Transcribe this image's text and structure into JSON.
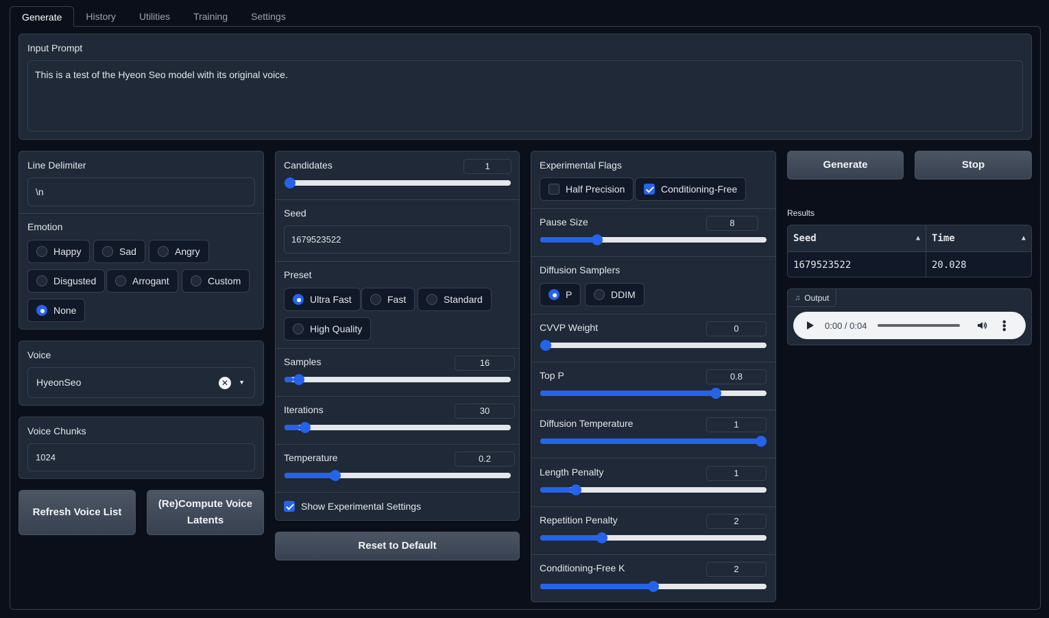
{
  "tabs": [
    "Generate",
    "History",
    "Utilities",
    "Training",
    "Settings"
  ],
  "input_prompt": {
    "label": "Input Prompt",
    "value": "This is a test of the Hyeon Seo model with its original voice."
  },
  "line_delimiter": {
    "label": "Line Delimiter",
    "value": "\\n"
  },
  "emotion": {
    "label": "Emotion",
    "options": [
      "Happy",
      "Sad",
      "Angry",
      "Disgusted",
      "Arrogant",
      "Custom",
      "None"
    ],
    "selected": "None"
  },
  "voice": {
    "label": "Voice",
    "value": "HyeonSeo"
  },
  "voice_chunks": {
    "label": "Voice Chunks",
    "value": "1024"
  },
  "buttons": {
    "refresh_voice_list": "Refresh Voice List",
    "recompute_latents": "(Re)Compute Voice Latents",
    "reset_to_default": "Reset to Default",
    "generate": "Generate",
    "stop": "Stop"
  },
  "candidates": {
    "label": "Candidates",
    "value": "1",
    "fraction": 0.0
  },
  "seed": {
    "label": "Seed",
    "value": "1679523522"
  },
  "preset": {
    "label": "Preset",
    "options": [
      "Ultra Fast",
      "Fast",
      "Standard",
      "High Quality"
    ],
    "selected": "Ultra Fast"
  },
  "samples": {
    "label": "Samples",
    "value": "16",
    "fraction": 0.04
  },
  "iterations": {
    "label": "Iterations",
    "value": "30",
    "fraction": 0.07
  },
  "temperature": {
    "label": "Temperature",
    "value": "0.2",
    "fraction": 0.21
  },
  "show_experimental": {
    "label": "Show Experimental Settings",
    "checked": true
  },
  "experimental_flags": {
    "label": "Experimental Flags",
    "half_precision": {
      "label": "Half Precision",
      "checked": false
    },
    "conditioning_free": {
      "label": "Conditioning-Free",
      "checked": true
    }
  },
  "pause_size": {
    "label": "Pause Size",
    "value": "8",
    "fraction": 0.24
  },
  "diffusion_samplers": {
    "label": "Diffusion Samplers",
    "options": [
      "P",
      "DDIM"
    ],
    "selected": "P"
  },
  "cvvp_weight": {
    "label": "CVVP Weight",
    "value": "0",
    "fraction": 0.0
  },
  "top_p": {
    "label": "Top P",
    "value": "0.8",
    "fraction": 0.79
  },
  "diffusion_temperature": {
    "label": "Diffusion Temperature",
    "value": "1",
    "fraction": 1.0
  },
  "length_penalty": {
    "label": "Length Penalty",
    "value": "1",
    "fraction": 0.14
  },
  "repetition_penalty": {
    "label": "Repetition Penalty",
    "value": "2",
    "fraction": 0.26
  },
  "conditioning_free_k": {
    "label": "Conditioning-Free K",
    "value": "2",
    "fraction": 0.5
  },
  "results": {
    "label": "Results",
    "columns": [
      "Seed",
      "Time"
    ],
    "rows": [
      [
        "1679523522",
        "20.028"
      ]
    ]
  },
  "output": {
    "label": "Output",
    "time": "0:00 / 0:04",
    "progress": 0.0
  },
  "icons": {
    "sort": "sort-up-icon",
    "clear": "clear-x-icon",
    "dropdown": "chevron-down-icon",
    "music": "music-note-icon",
    "play": "play-icon",
    "volume": "volume-icon",
    "more": "more-vertical-icon"
  },
  "colors": {
    "accent": "#2563eb",
    "panel": "#1f2937",
    "background": "#0b0f19",
    "border": "#374151"
  }
}
